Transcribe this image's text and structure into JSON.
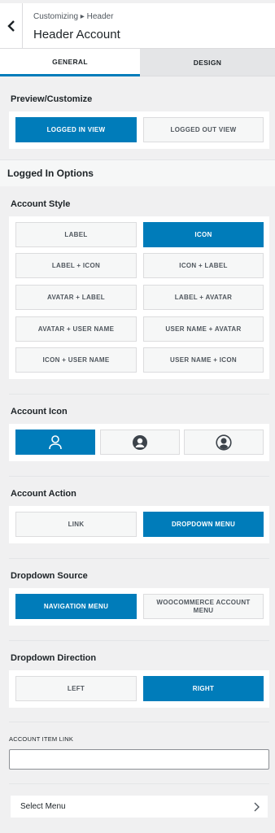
{
  "header": {
    "breadcrumb": "Customizing ▸ Header",
    "title": "Header Account",
    "back_icon": "chevron-left-icon"
  },
  "tabs": [
    {
      "label": "GENERAL",
      "active": true
    },
    {
      "label": "DESIGN",
      "active": false
    }
  ],
  "preview": {
    "title": "Preview/Customize",
    "options": [
      {
        "label": "LOGGED IN VIEW",
        "active": true
      },
      {
        "label": "LOGGED OUT VIEW",
        "active": false
      }
    ]
  },
  "logged_in_options": {
    "title": "Logged In Options"
  },
  "account_style": {
    "title": "Account Style",
    "options": [
      {
        "label": "LABEL",
        "active": false
      },
      {
        "label": "ICON",
        "active": true
      },
      {
        "label": "LABEL + ICON",
        "active": false
      },
      {
        "label": "ICON + LABEL",
        "active": false
      },
      {
        "label": "AVATAR + LABEL",
        "active": false
      },
      {
        "label": "LABEL + AVATAR",
        "active": false
      },
      {
        "label": "AVATAR + USER NAME",
        "active": false
      },
      {
        "label": "USER NAME + AVATAR",
        "active": false
      },
      {
        "label": "ICON + USER NAME",
        "active": false
      },
      {
        "label": "USER NAME + ICON",
        "active": false
      }
    ]
  },
  "account_icon": {
    "title": "Account Icon",
    "options": [
      {
        "icon": "user-outline-icon",
        "active": true
      },
      {
        "icon": "user-circle-filled-icon",
        "active": false
      },
      {
        "icon": "user-circle-outline-icon",
        "active": false
      }
    ]
  },
  "account_action": {
    "title": "Account Action",
    "options": [
      {
        "label": "LINK",
        "active": false
      },
      {
        "label": "DROPDOWN MENU",
        "active": true
      }
    ]
  },
  "dropdown_source": {
    "title": "Dropdown Source",
    "options": [
      {
        "label": "NAVIGATION MENU",
        "active": true
      },
      {
        "label": "WOOCOMMERCE ACCOUNT MENU",
        "active": false
      }
    ]
  },
  "dropdown_direction": {
    "title": "Dropdown Direction",
    "options": [
      {
        "label": "LEFT",
        "active": false
      },
      {
        "label": "RIGHT",
        "active": true
      }
    ]
  },
  "account_item_link": {
    "label": "ACCOUNT ITEM LINK",
    "value": "",
    "placeholder": ""
  },
  "select_menu": {
    "label": "Select Menu",
    "icon": "chevron-right-icon"
  },
  "colors": {
    "accent": "#007cba",
    "panel_bg": "#ffffff",
    "page_bg": "#f0f0f1"
  }
}
